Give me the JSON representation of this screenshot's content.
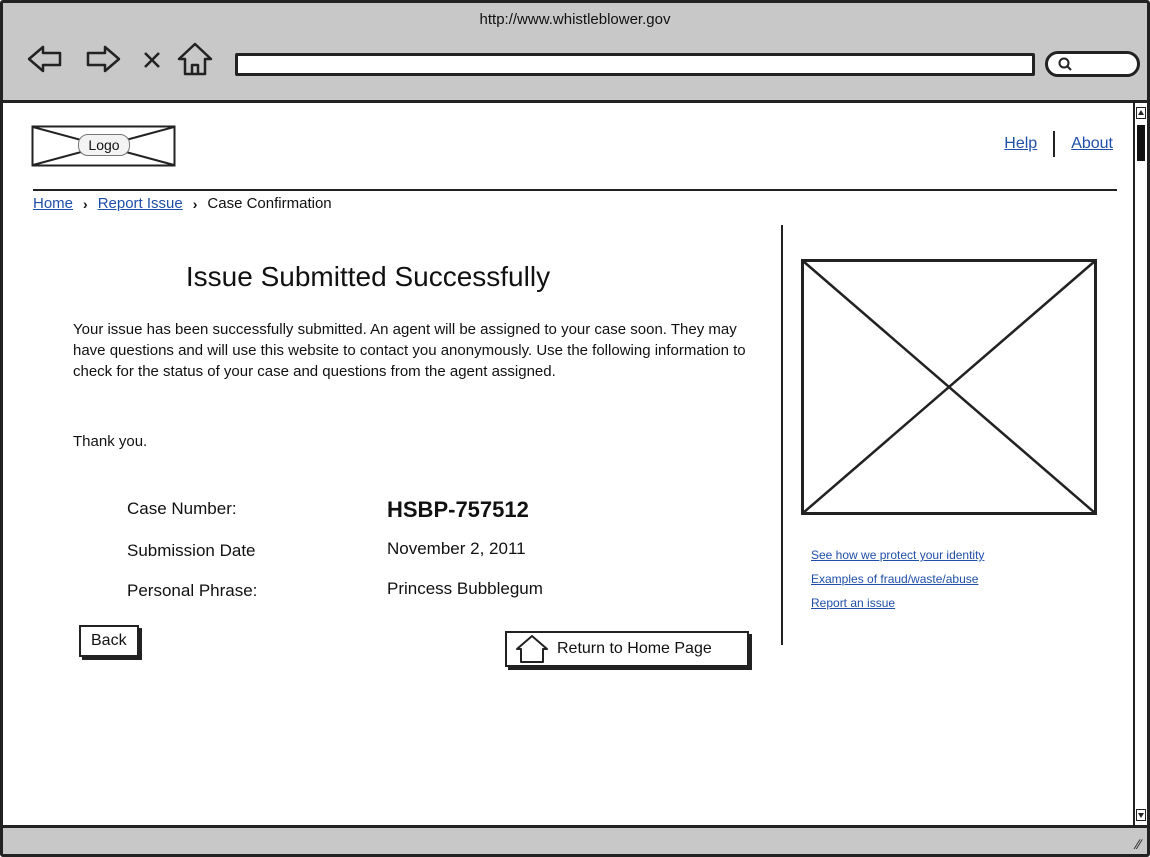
{
  "browser": {
    "title": "http://www.whistleblower.gov",
    "address_value": "",
    "icons": {
      "back": "arrow-left-icon",
      "forward": "arrow-right-icon",
      "stop": "close-icon",
      "home": "home-icon",
      "search": "search-icon"
    }
  },
  "header": {
    "logo_label": "Logo",
    "links": [
      "Help",
      "About"
    ]
  },
  "breadcrumb": {
    "items": [
      "Home",
      "Report Issue",
      "Case Confirmation"
    ]
  },
  "main": {
    "heading": "Issue Submitted Successfully",
    "paragraph": "Your issue has been successfully submitted.  An agent will be assigned to your case soon.  They may have questions and will use this website to contact you anonymously.  Use the following information to check for the status of your case and questions from the agent assigned.",
    "thanks": "Thank you.",
    "case_number_label": "Case Number:",
    "case_number": "HSBP-757512",
    "submission_date_label": "Submission Date",
    "submission_date": "November 2, 2011",
    "personal_phrase_label": "Personal Phrase:",
    "personal_phrase": "Princess Bubblegum",
    "back_button": "Back",
    "home_button": "Return to Home Page"
  },
  "sidebar": {
    "links": [
      "See how we protect your identity",
      "Examples of fraud/waste/abuse",
      "Report an issue"
    ]
  },
  "colors": {
    "chrome": "#c8c8c8",
    "link": "#1f4fa8",
    "border": "#222222"
  }
}
